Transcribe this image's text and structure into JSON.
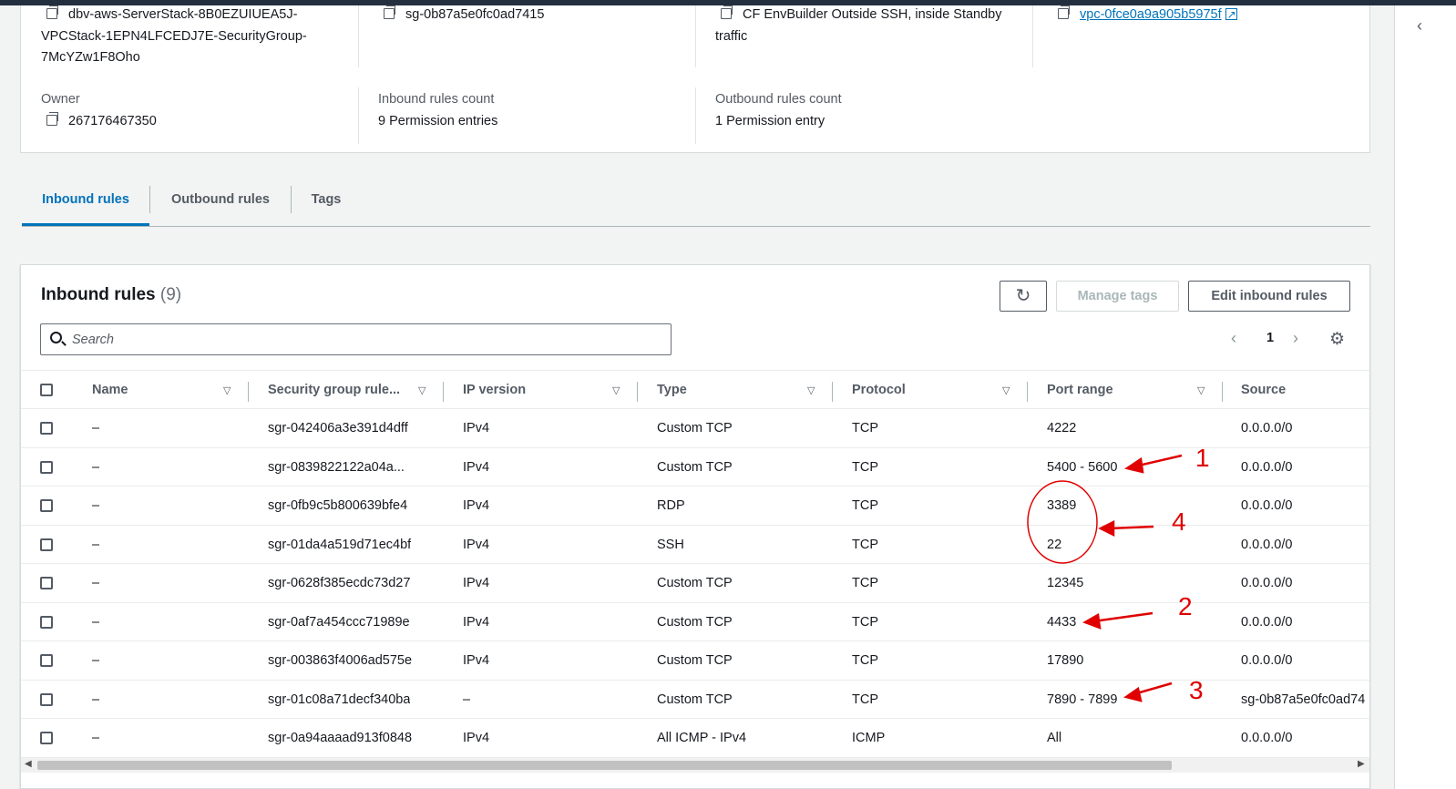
{
  "details": {
    "security_group_name": "dbv-aws-ServerStack-8B0EZUIUEA5J-VPCStack-1EPN4LFCEDJ7E-SecurityGroup-7McYZw1F8Oho",
    "name_lines": [
      "dbv-aws-ServerStack-8B0EZUIUEA5J-",
      "VPCStack-1EPN4LFCEDJ7E-SecurityGroup-",
      "7McYZw1F8Oho"
    ],
    "security_group_id": "sg-0b87a5e0fc0ad7415",
    "description_lines": [
      "CF EnvBuilder Outside SSH, inside Standby",
      "traffic"
    ],
    "vpc_id": "vpc-0fce0a9a905b5975f",
    "owner_label": "Owner",
    "owner_value": "267176467350",
    "inbound_count_label": "Inbound rules count",
    "inbound_count_value": "9 Permission entries",
    "outbound_count_label": "Outbound rules count",
    "outbound_count_value": "1 Permission entry"
  },
  "tabs": [
    {
      "label": "Inbound rules",
      "active": true
    },
    {
      "label": "Outbound rules",
      "active": false
    },
    {
      "label": "Tags",
      "active": false
    }
  ],
  "panel": {
    "title": "Inbound rules",
    "count": "(9)",
    "refresh_icon": "↻",
    "manage_tags_label": "Manage tags",
    "edit_label": "Edit inbound rules",
    "search_placeholder": "Search",
    "page_number": "1",
    "prev_icon": "‹",
    "next_icon": "›",
    "gear_icon": "⚙"
  },
  "columns": [
    "Name",
    "Security group rule...",
    "IP version",
    "Type",
    "Protocol",
    "Port range",
    "Source"
  ],
  "sort_icon": "▽",
  "rows": [
    {
      "name": "–",
      "rule_id": "sgr-042406a3e391d4dff",
      "ip_version": "IPv4",
      "type": "Custom TCP",
      "protocol": "TCP",
      "port_range": "4222",
      "source": "0.0.0.0/0"
    },
    {
      "name": "–",
      "rule_id": "sgr-0839822122a04a...",
      "ip_version": "IPv4",
      "type": "Custom TCP",
      "protocol": "TCP",
      "port_range": "5400 - 5600",
      "source": "0.0.0.0/0"
    },
    {
      "name": "–",
      "rule_id": "sgr-0fb9c5b800639bfe4",
      "ip_version": "IPv4",
      "type": "RDP",
      "protocol": "TCP",
      "port_range": "3389",
      "source": "0.0.0.0/0"
    },
    {
      "name": "–",
      "rule_id": "sgr-01da4a519d71ec4bf",
      "ip_version": "IPv4",
      "type": "SSH",
      "protocol": "TCP",
      "port_range": "22",
      "source": "0.0.0.0/0"
    },
    {
      "name": "–",
      "rule_id": "sgr-0628f385ecdc73d27",
      "ip_version": "IPv4",
      "type": "Custom TCP",
      "protocol": "TCP",
      "port_range": "12345",
      "source": "0.0.0.0/0"
    },
    {
      "name": "–",
      "rule_id": "sgr-0af7a454ccc71989e",
      "ip_version": "IPv4",
      "type": "Custom TCP",
      "protocol": "TCP",
      "port_range": "4433",
      "source": "0.0.0.0/0"
    },
    {
      "name": "–",
      "rule_id": "sgr-003863f4006ad575e",
      "ip_version": "IPv4",
      "type": "Custom TCP",
      "protocol": "TCP",
      "port_range": "17890",
      "source": "0.0.0.0/0"
    },
    {
      "name": "–",
      "rule_id": "sgr-01c08a71decf340ba",
      "ip_version": "–",
      "type": "Custom TCP",
      "protocol": "TCP",
      "port_range": "7890 - 7899",
      "source": "sg-0b87a5e0fc0ad74"
    },
    {
      "name": "–",
      "rule_id": "sgr-0a94aaaad913f0848",
      "ip_version": "IPv4",
      "type": "All ICMP - IPv4",
      "protocol": "ICMP",
      "port_range": "All",
      "source": "0.0.0.0/0"
    }
  ],
  "annotations": {
    "a1": "1",
    "a2": "2",
    "a3": "3",
    "a4": "4",
    "color": "#e00000"
  },
  "colors": {
    "accent": "#0073bb",
    "header_bar": "#232f3e",
    "text": "#16191f",
    "muted": "#545b64"
  }
}
